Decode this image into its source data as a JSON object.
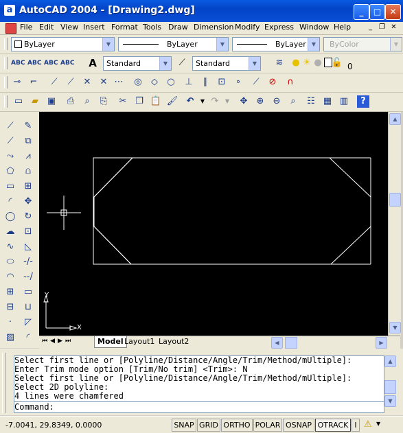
{
  "window": {
    "title": "AutoCAD 2004 - [Drawing2.dwg]",
    "app_icon": "a"
  },
  "menu": [
    "File",
    "Edit",
    "View",
    "Insert",
    "Format",
    "Tools",
    "Draw",
    "Dimension",
    "Modify",
    "Express",
    "Window",
    "Help"
  ],
  "properties_toolbar": {
    "color": "ByLayer",
    "linetype": "ByLayer",
    "lineweight": "ByLayer",
    "plotstyle": "ByColor"
  },
  "styles_toolbar": {
    "text_style": "Standard",
    "dim_style": "Standard",
    "layer": "0"
  },
  "layout_tabs": [
    "Model",
    "Layout1",
    "Layout2"
  ],
  "command_history": [
    "Select first line or [Polyline/Distance/Angle/Trim/Method/mUltiple]:",
    "Enter Trim mode option [Trim/No trim] <Trim>: N",
    "Select first line or [Polyline/Distance/Angle/Trim/Method/mUltiple]:",
    "Select 2D polyline:",
    "4 lines were chamfered"
  ],
  "command_prompt": "Command:",
  "status": {
    "coordinates": "-7.0041, 29.8349, 0.0000",
    "toggles": [
      "SNAP",
      "GRID",
      "ORTHO",
      "POLAR",
      "OSNAP",
      "OTRACK",
      "I"
    ],
    "active_toggle": "OTRACK"
  },
  "ucs": {
    "x_label": "X",
    "y_label": "Y"
  },
  "colors": {
    "titlebar": "#0344c8",
    "canvas_bg": "#000000",
    "drawing_lines": "#ffffff"
  }
}
